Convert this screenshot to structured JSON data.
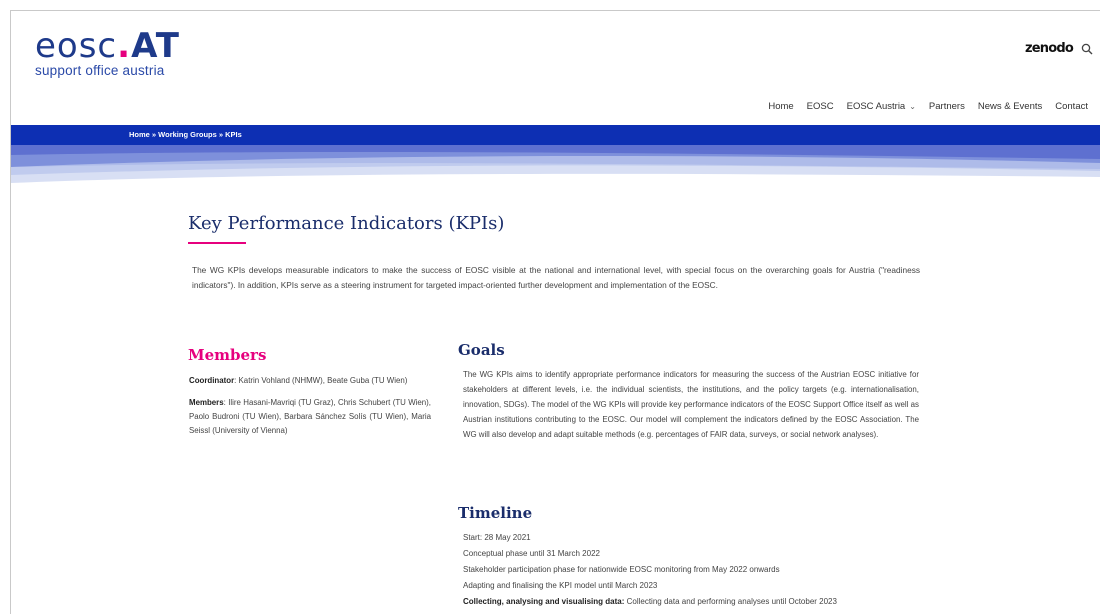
{
  "header": {
    "logo_main_a": "eosc",
    "logo_dot": ".",
    "logo_main_b": "AT",
    "logo_sub": "support office austria",
    "zenodo": "zenodo",
    "search_icon": "search-icon"
  },
  "nav": {
    "items": [
      "Home",
      "EOSC",
      "EOSC Austria",
      "Partners",
      "News & Events",
      "Contact"
    ],
    "dropdown_icon": "chevron-down-icon"
  },
  "breadcrumb": "Home » Working Groups » KPIs",
  "page": {
    "title": "Key Performance Indicators (KPIs)",
    "intro": "The WG KPIs develops measurable indicators to make the success of EOSC visible at the national and international level, with special focus on the overarching goals for Austria (\"readiness indicators\"). In addition, KPIs serve as a steering instrument for targeted impact-oriented further development and implementation of the EOSC."
  },
  "members": {
    "heading": "Members",
    "coordinator_label": "Coordinator",
    "coordinator_text": ": Katrin Vohland (NHMW), Beate Guba (TU Wien)",
    "members_label": "Members",
    "members_text": ": Ilire Hasani-Mavriqi (TU Graz), Chris Schubert (TU Wien), Paolo Budroni (TU Wien), Barbara Sánchez Solís (TU Wien), Maria Seissl (University of Vienna)"
  },
  "goals": {
    "heading": "Goals",
    "text": "The WG KPIs aims to identify appropriate performance indicators for measuring the success of the Austrian EOSC initiative for stakeholders at different levels, i.e. the individual scientists, the institutions, and the policy targets (e.g. internationalisation, innovation, SDGs). The model of the WG KPIs will provide key performance indicators of the EOSC Support Office itself as well as Austrian institutions contributing to the EOSC. Our model will complement the indicators defined by the EOSC Association. The WG will also develop and adapt suitable methods (e.g. percentages of FAIR data, surveys, or social network analyses)."
  },
  "timeline": {
    "heading": "Timeline",
    "items": [
      "Start: 28 May 2021",
      "Conceptual phase until 31 March 2022",
      "Stakeholder participation phase for nationwide EOSC monitoring from May 2022 onwards",
      "Adapting and finalising the KPI model until March 2023"
    ],
    "last_label": "Collecting, analysing and visualising data:",
    "last_text": " Collecting data and performing analyses until October 2023"
  },
  "colors": {
    "brand_blue": "#0d2fb3",
    "heading_navy": "#1a2d6b",
    "accent_pink": "#e6007e"
  }
}
